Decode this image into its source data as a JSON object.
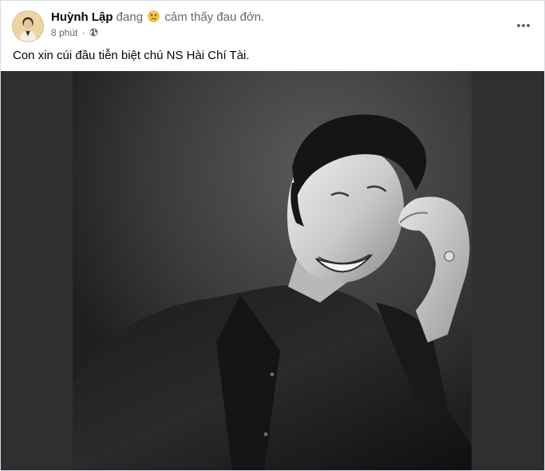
{
  "post": {
    "author": "Huỳnh Lập",
    "activity_prefix": "đang",
    "feeling_icon": "sad-face-icon",
    "feeling_text": "cảm thấy đau đớn.",
    "time": "8 phút",
    "separator": "·",
    "privacy_icon": "globe-icon",
    "caption": "Con xin cúi đầu tiễn biệt chú NS Hài Chí Tài."
  },
  "colors": {
    "author": "#050505",
    "meta": "#65676b",
    "photo_background": "#2f2f2f"
  }
}
